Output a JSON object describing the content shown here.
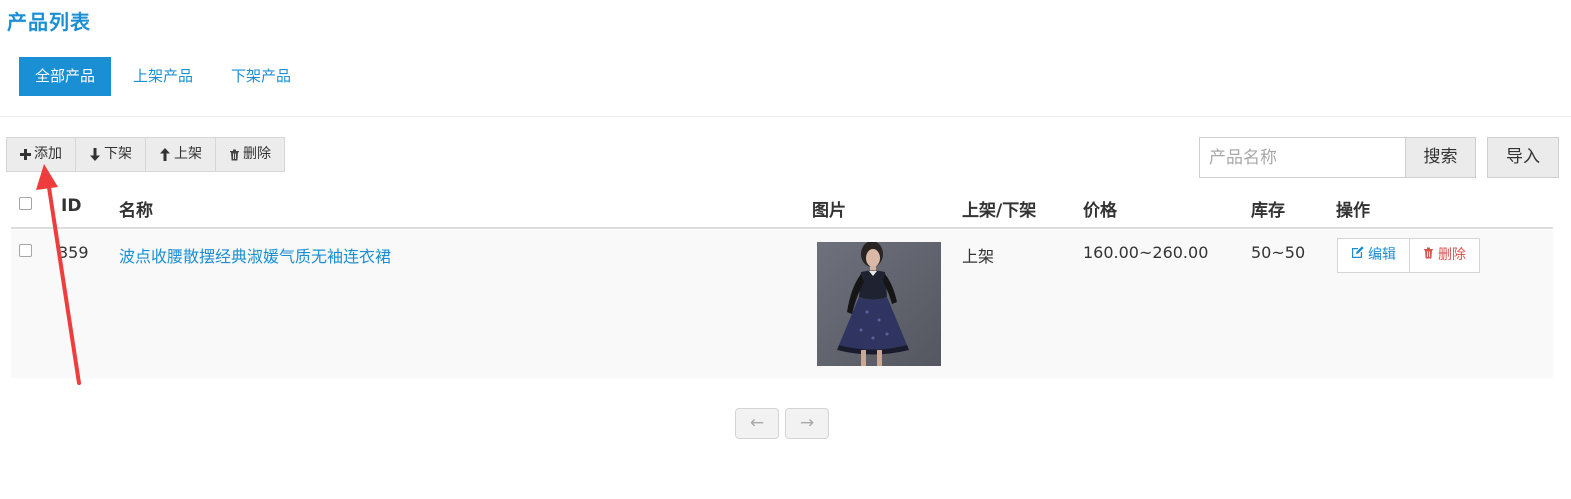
{
  "page": {
    "title": "产品列表"
  },
  "tabs": [
    {
      "label": "全部产品",
      "active": true
    },
    {
      "label": "上架产品",
      "active": false
    },
    {
      "label": "下架产品",
      "active": false
    }
  ],
  "toolbar": {
    "add_label": "添加",
    "unshelve_label": "下架",
    "shelve_label": "上架",
    "delete_label": "删除"
  },
  "search": {
    "placeholder": "产品名称",
    "value": "",
    "button_label": "搜索"
  },
  "import_label": "导入",
  "table": {
    "columns": [
      "ID",
      "名称",
      "图片",
      "上架/下架",
      "价格",
      "库存",
      "操作"
    ],
    "rows": [
      {
        "id": "359",
        "name": "波点收腰散摆经典淑媛气质无袖连衣裙",
        "image": "dress-photo",
        "status": "上架",
        "price": "160.00~260.00",
        "stock": "50~50",
        "edit_label": "编辑",
        "delete_label": "删除"
      }
    ]
  },
  "pagination": {
    "prev": "←",
    "next": "→"
  },
  "colors": {
    "accent": "#1a8fd3",
    "danger": "#d9534f",
    "annotation": "#f03c3c"
  }
}
